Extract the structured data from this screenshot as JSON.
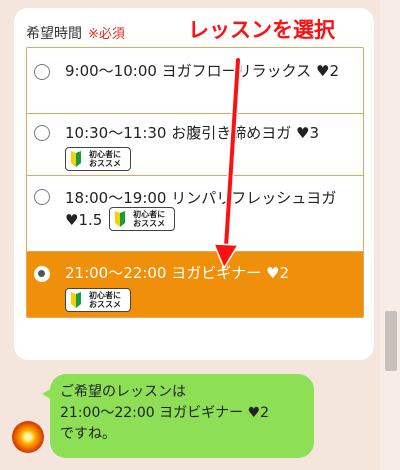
{
  "form": {
    "label": "希望時間",
    "required": "※必須",
    "options": [
      {
        "text": "9:00〜10:00 ヨガフローリラックス ♥2",
        "selected": false,
        "badge": false
      },
      {
        "text": "10:30〜11:30 お腹引き締めヨガ ♥3",
        "selected": false,
        "badge": true
      },
      {
        "text": "18:00〜19:00 リンパリフレッシュヨガ ♥1.5",
        "selected": false,
        "badge": true
      },
      {
        "text": "21:00〜22:00 ヨガビギナー ♥2",
        "selected": true,
        "badge": true
      }
    ],
    "badge_line1": "初心者に",
    "badge_line2": "おススメ"
  },
  "annotation": {
    "text": "レッスンを選択",
    "color": "#ff1010"
  },
  "chat": {
    "line1": "ご希望のレッスンは",
    "line2": "21:00〜22:00 ヨガビギナー ♥2",
    "line3": "ですね。"
  },
  "colors": {
    "accent": "#ef8f0a",
    "bubble": "#8de055",
    "background": "#f5e6dd"
  },
  "icons": {
    "badge": "beginner-leaf-icon",
    "avatar": "sun-avatar-icon"
  }
}
